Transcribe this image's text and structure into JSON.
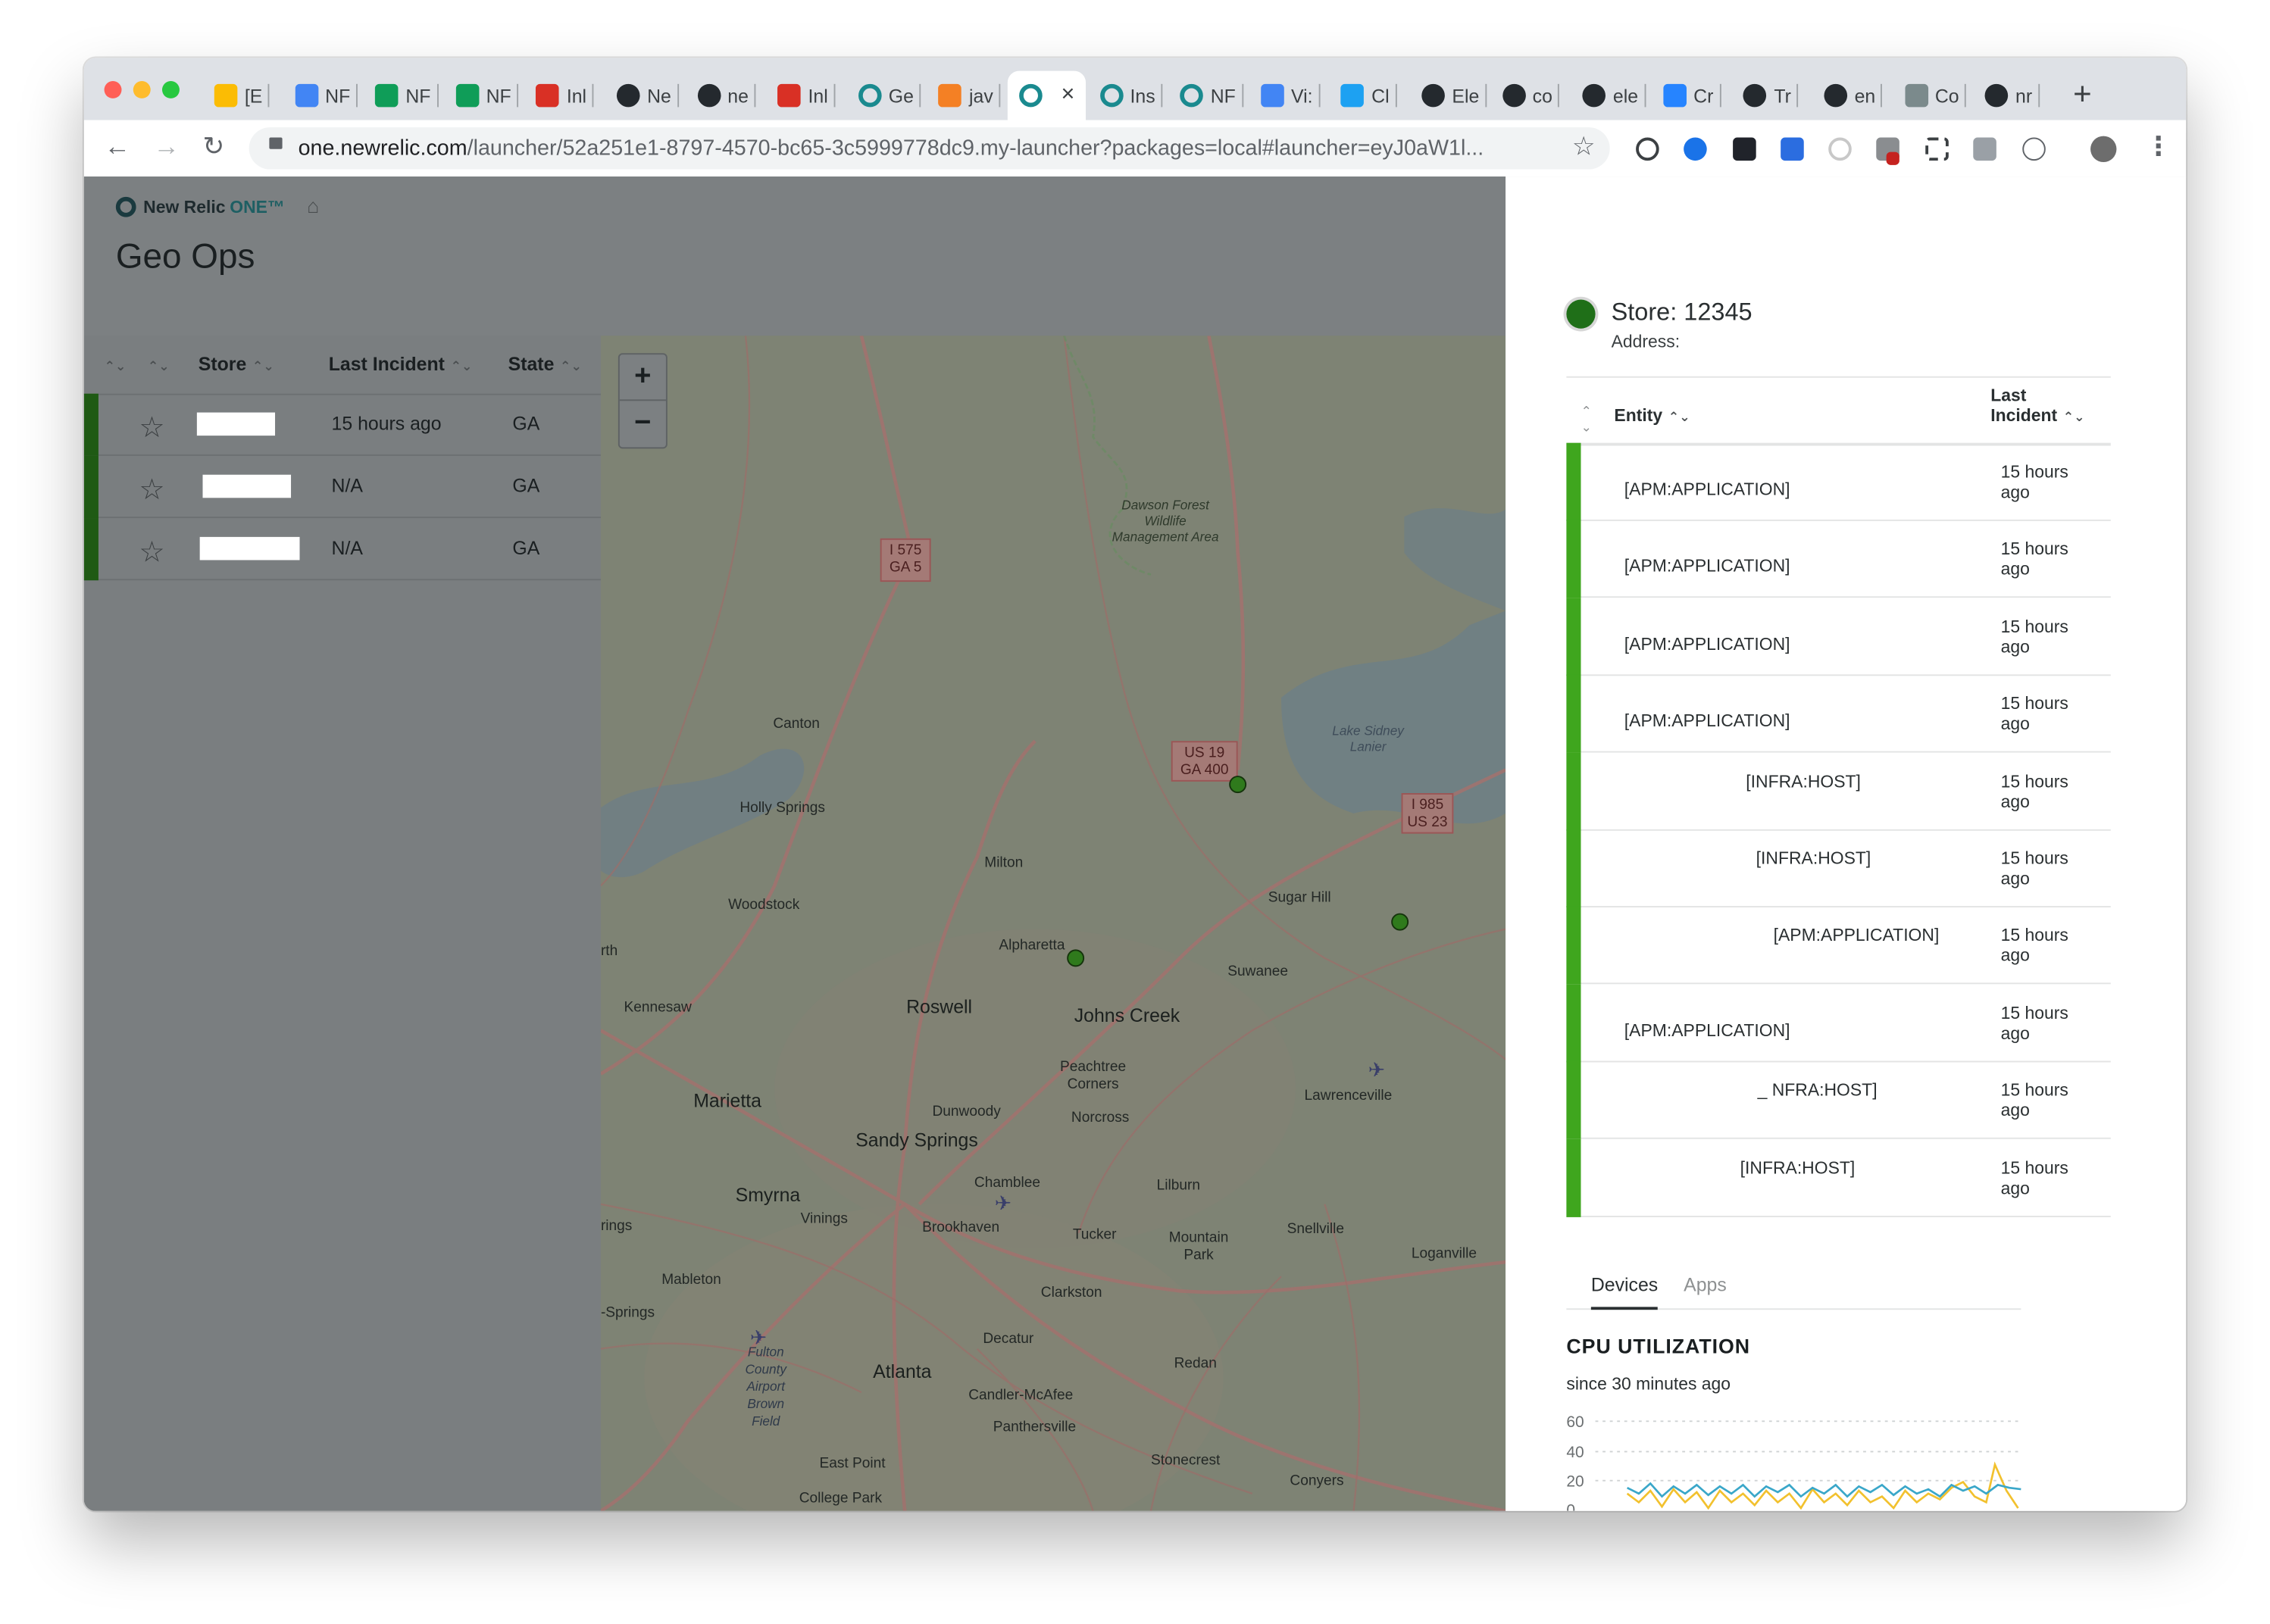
{
  "browser": {
    "tabs": [
      {
        "label": "[E",
        "icon": "drive-icon",
        "color": "#fbbc04"
      },
      {
        "label": "NF",
        "icon": "docs-icon",
        "color": "#4285f4"
      },
      {
        "label": "NF",
        "icon": "sheets-icon",
        "color": "#0f9d58"
      },
      {
        "label": "NF",
        "icon": "sheets-icon",
        "color": "#0f9d58"
      },
      {
        "label": "Inl",
        "icon": "gmail-icon",
        "color": "#d93025"
      },
      {
        "label": "Ne",
        "icon": "github-icon",
        "color": "#24292e"
      },
      {
        "label": "ne",
        "icon": "github-icon",
        "color": "#24292e"
      },
      {
        "label": "Inl",
        "icon": "gmail-icon",
        "color": "#d93025"
      },
      {
        "label": "Ge",
        "icon": "newrelic-icon",
        "color": "#1a8a8f"
      },
      {
        "label": "jav",
        "icon": "stackoverflow-icon",
        "color": "#f48024"
      },
      {
        "label": "",
        "icon": "newrelic-icon",
        "color": "#1a8a8f",
        "active": true
      },
      {
        "label": "Ins",
        "icon": "newrelic-icon",
        "color": "#1a8a8f"
      },
      {
        "label": "NF",
        "icon": "newrelic-icon",
        "color": "#1a8a8f"
      },
      {
        "label": "Vi:",
        "icon": "docs-icon",
        "color": "#4285f4"
      },
      {
        "label": "Cl",
        "icon": "bird-icon",
        "color": "#1da1f2"
      },
      {
        "label": "Ele",
        "icon": "github-icon",
        "color": "#24292e"
      },
      {
        "label": "co",
        "icon": "github-icon",
        "color": "#24292e"
      },
      {
        "label": "ele",
        "icon": "github-icon",
        "color": "#24292e"
      },
      {
        "label": "Cr",
        "icon": "jira-icon",
        "color": "#2684ff"
      },
      {
        "label": "Tr",
        "icon": "github-icon",
        "color": "#24292e"
      },
      {
        "label": "en",
        "icon": "github-icon",
        "color": "#24292e"
      },
      {
        "label": "Co",
        "icon": "gear-icon",
        "color": "#7b8a8c"
      },
      {
        "label": "nr",
        "icon": "github-icon",
        "color": "#24292e"
      }
    ],
    "url_host": "one.newrelic.com",
    "url_path": "/launcher/52a251e1-8797-4570-bc65-3c5999778dc9.my-launcher?packages=local#launcher=eyJ0aW1l..."
  },
  "app": {
    "brand": "New Relic",
    "brand_suffix": "ONE™",
    "title": "Geo Ops"
  },
  "store_table": {
    "headers": {
      "store": "Store",
      "last_incident": "Last Incident",
      "state": "State"
    },
    "rows": [
      {
        "last_incident": "15 hours ago",
        "state": "GA"
      },
      {
        "last_incident": "N/A",
        "state": "GA"
      },
      {
        "last_incident": "N/A",
        "state": "GA"
      }
    ]
  },
  "map": {
    "labels": {
      "i575": "I 575",
      "ga5": "GA 5",
      "dawson": "Dawson Forest Wildlife Management Area",
      "canton": "Canton",
      "holly": "Holly Springs",
      "milton": "Milton",
      "woodstock": "Woodstock",
      "us19": "US 19",
      "ga400": "GA 400",
      "i985": "I 985",
      "us23": "US 23",
      "lanier": "Lake Sidney Lanier",
      "sugarhill": "Sugar Hill",
      "alpharetta": "Alpharetta",
      "suwanee": "Suwanee",
      "kennesaw": "Kennesaw",
      "roswell": "Roswell",
      "johnscreek": "Johns Creek",
      "marietta": "Marietta",
      "peachtree": "Peachtree Corners",
      "norcross": "Norcross",
      "dunwoody": "Dunwoody",
      "lawrenceville": "Lawrenceville",
      "sandysprings": "Sandy Springs",
      "smyrna": "Smyrna",
      "vinings": "Vinings",
      "chamblee": "Chamblee",
      "lilburn": "Lilburn",
      "brookhaven": "Brookhaven",
      "tucker": "Tucker",
      "mountainpark": "Mountain Park",
      "snellville": "Snellville",
      "loganville": "Loganville",
      "mableton": "Mableton",
      "clarkston": "Clarkston",
      "decatur": "Decatur",
      "atlanta": "Atlanta",
      "redan": "Redan",
      "candler": "Candler-McAfee",
      "panthersville": "Panthersville",
      "fulton": "Fulton County Airport Brown Field",
      "eastpoint": "East Point",
      "collegepark": "College Park",
      "stonecrest": "Stonecrest",
      "conyers": "Conyers",
      "springs": "-Springs",
      "rings": "rings",
      "rth": "rth"
    }
  },
  "detail": {
    "store_title": "Store: 12345",
    "address_label": "Address:",
    "headers": {
      "entity": "Entity",
      "last_incident": "Last Incident"
    },
    "entities": [
      {
        "name": "[APM:APPLICATION]",
        "time": "15 hours ago"
      },
      {
        "name": "[APM:APPLICATION]",
        "time": "15 hours ago"
      },
      {
        "name": "[APM:APPLICATION]",
        "time": "15 hours ago"
      },
      {
        "name": "[APM:APPLICATION]",
        "time": "15 hours ago"
      },
      {
        "name": "[INFRA:HOST]",
        "time": "15 hours ago"
      },
      {
        "name": "[INFRA:HOST]",
        "time": "15 hours ago"
      },
      {
        "name": "[APM:APPLICATION]",
        "time": "15 hours ago"
      },
      {
        "name": "[APM:APPLICATION]",
        "time": "15 hours ago"
      },
      {
        "name": "_ NFRA:HOST]",
        "time": "15 hours ago"
      },
      {
        "name": "[INFRA:HOST]",
        "time": "15 hours ago"
      }
    ],
    "tabs": [
      "Devices",
      "Apps"
    ],
    "cpu_title": "CPU UTILIZATION",
    "cpu_subtitle": "since 30 minutes ago",
    "cpu_ticks": [
      "60",
      "40",
      "20",
      "0"
    ]
  },
  "colors": {
    "healthy_green": "#3fa61e",
    "store_green": "#1f5a14",
    "series_yellow": "#f2c12e",
    "series_blue": "#3aa7c9"
  }
}
